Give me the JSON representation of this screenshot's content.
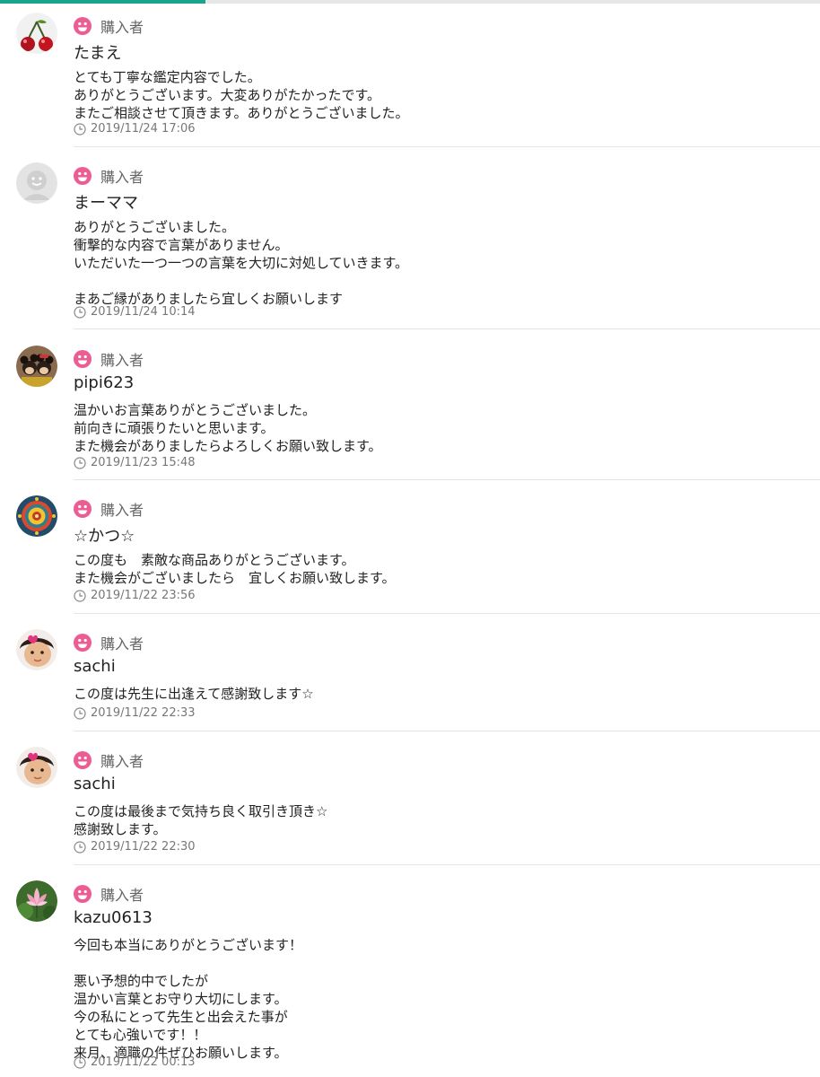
{
  "progress": {
    "fraction": 0.25
  },
  "colors": {
    "accent": "#19a58c",
    "badge": "#ec5e93"
  },
  "reviews": [
    {
      "badge": "購入者",
      "avatar": "cherry-avatar",
      "name": "たまえ",
      "message": "とても丁寧な鑑定内容でした。\nありがとうございます。大変ありがたかったです。\nまたご相談させて頂きます。ありがとうございました。",
      "date": "2019/11/24 17:06"
    },
    {
      "badge": "購入者",
      "avatar": "default-avatar",
      "name": "まーママ",
      "message": "ありがとうございました。\n衝撃的な内容で言葉がありません。\nいただいた一つ一つの言葉を大切に対処していきます。\n\nまあご縁がありましたら宜しくお願いします",
      "date": "2019/11/24 10:14"
    },
    {
      "badge": "購入者",
      "avatar": "mouse-couple-avatar",
      "name": "pipi623",
      "message": "温かいお言葉ありがとうございました。\n前向きに頑張りたいと思います。\nまた機会がありましたらよろしくお願い致します。",
      "date": "2019/11/23 15:48"
    },
    {
      "badge": "購入者",
      "avatar": "mandala-avatar",
      "name": "☆かつ☆",
      "message": "この度も　素敵な商品ありがとうございます。\nまた機会がございましたら　宜しくお願い致します。",
      "date": "2019/11/22 23:56"
    },
    {
      "badge": "購入者",
      "avatar": "child-avatar",
      "name": "sachi",
      "message": "この度は先生に出逢えて感謝致します☆",
      "date": "2019/11/22 22:33"
    },
    {
      "badge": "購入者",
      "avatar": "child-avatar",
      "name": "sachi",
      "message": "この度は最後まで気持ち良く取引き頂き☆\n感謝致します。",
      "date": "2019/11/22 22:30"
    },
    {
      "badge": "購入者",
      "avatar": "lotus-avatar",
      "name": "kazu0613",
      "message": "今回も本当にありがとうございます！\n\n悪い予想的中でしたが\n温かい言葉とお守り大切にします。\n今の私にとって先生と出会えた事が\nとても心強いです！！\n来月、適職の件ぜひお願いします。",
      "date": "2019/11/22 00:13"
    }
  ]
}
